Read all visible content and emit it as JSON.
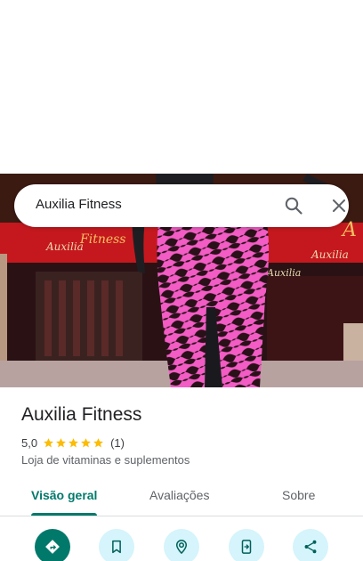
{
  "search": {
    "query": "Auxilia Fitness"
  },
  "place": {
    "name": "Auxilia Fitness",
    "rating": "5,0",
    "stars": 5,
    "review_count": "(1)",
    "category": "Loja de vitaminas e suplementos"
  },
  "tabs": [
    {
      "label": "Visão geral",
      "selected": true
    },
    {
      "label": "Avaliações",
      "selected": false
    },
    {
      "label": "Sobre",
      "selected": false
    }
  ],
  "actions": [
    {
      "icon": "directions-icon"
    },
    {
      "icon": "bookmark-icon"
    },
    {
      "icon": "nearby-icon"
    },
    {
      "icon": "send-to-phone-icon"
    },
    {
      "icon": "share-icon"
    }
  ],
  "colors": {
    "accent": "#00796b",
    "action_bg": "#d5f4fb",
    "star": "#fbbc04"
  }
}
